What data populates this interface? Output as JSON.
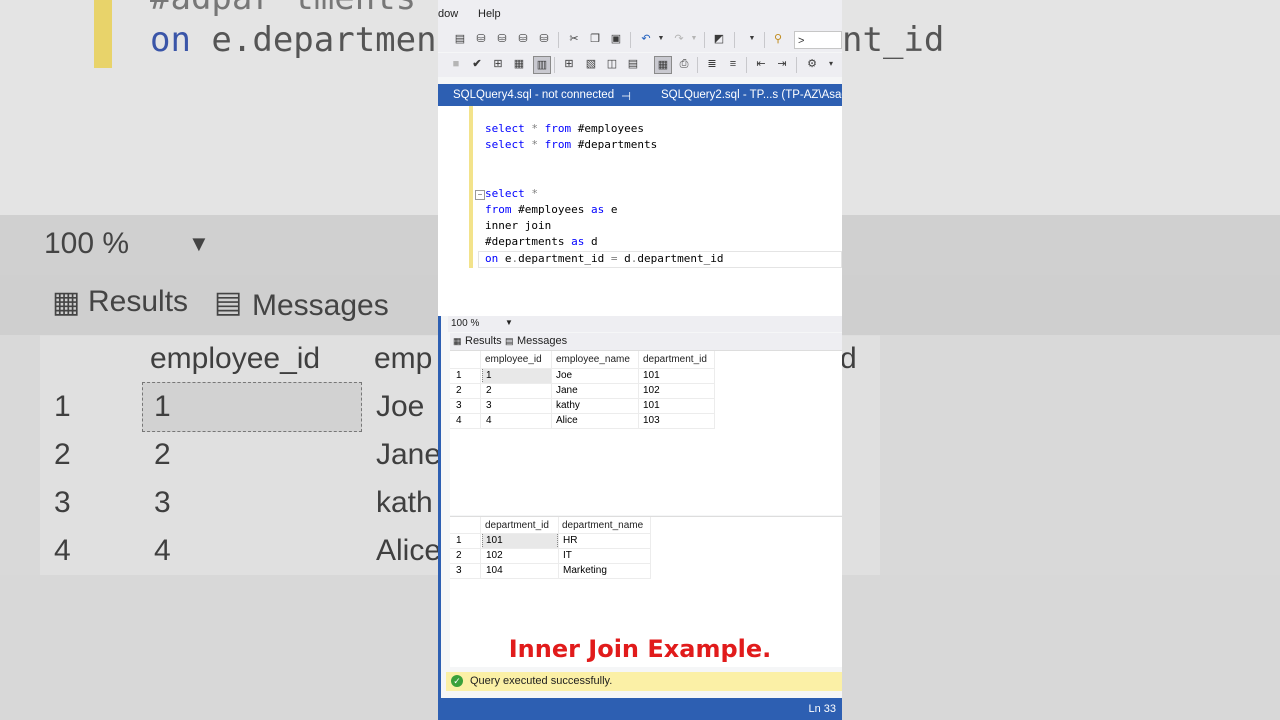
{
  "menu": {
    "window_partial": "dow",
    "help": "Help"
  },
  "toolbar": {
    "search_text": ">"
  },
  "tabs": {
    "tab1": "SQLQuery4.sql - not connected",
    "pin": "⊣",
    "tab2": "SQLQuery2.sql - TP...s (TP-AZ\\Asad"
  },
  "code": {
    "l1": [
      "select",
      " * ",
      "from",
      " #employees"
    ],
    "l2": [
      "select",
      " * ",
      "from",
      " #departments"
    ],
    "l3": [
      "select",
      " *"
    ],
    "l4": [
      "from",
      " #employees ",
      "as",
      " e"
    ],
    "l5": "inner join",
    "l6": [
      "#departments ",
      "as",
      " d"
    ],
    "l7": [
      "on",
      " e",
      ".",
      "department_id ",
      "=",
      " d",
      ".",
      "department_id"
    ]
  },
  "zoom": {
    "value": "100 %"
  },
  "results_tabs": {
    "results": "Results",
    "messages": "Messages"
  },
  "employees_grid": {
    "headers": [
      "employee_id",
      "employee_name",
      "department_id"
    ],
    "rows": [
      [
        "1",
        "1",
        "Joe",
        "101"
      ],
      [
        "2",
        "2",
        "Jane",
        "102"
      ],
      [
        "3",
        "3",
        "kathy",
        "101"
      ],
      [
        "4",
        "4",
        "Alice",
        "103"
      ]
    ]
  },
  "departments_grid": {
    "headers": [
      "department_id",
      "department_name"
    ],
    "rows": [
      [
        "1",
        "101",
        "HR"
      ],
      [
        "2",
        "102",
        "IT"
      ],
      [
        "3",
        "104",
        "Marketing"
      ]
    ]
  },
  "caption": "Inner Join Example.",
  "status": {
    "message": "Query executed successfully.",
    "line": "Ln 33"
  },
  "background": {
    "code_top": "#adpar tments",
    "code_kw": "on",
    "code_rest": " e.department_id",
    "code_right": "nt_id",
    "zoom": "100 %",
    "tab_results": "Results",
    "tab_messages": "Messages",
    "header1": "employee_id",
    "header2": "emp",
    "header3": "d",
    "rows": [
      [
        "1",
        "1",
        "Joe"
      ],
      [
        "2",
        "2",
        "Jane"
      ],
      [
        "3",
        "3",
        "kath"
      ],
      [
        "4",
        "4",
        "Alice"
      ]
    ]
  },
  "colors": {
    "accent": "#2d5fb2",
    "caption": "#e11b1b",
    "status_bg": "#fbf0a6"
  }
}
